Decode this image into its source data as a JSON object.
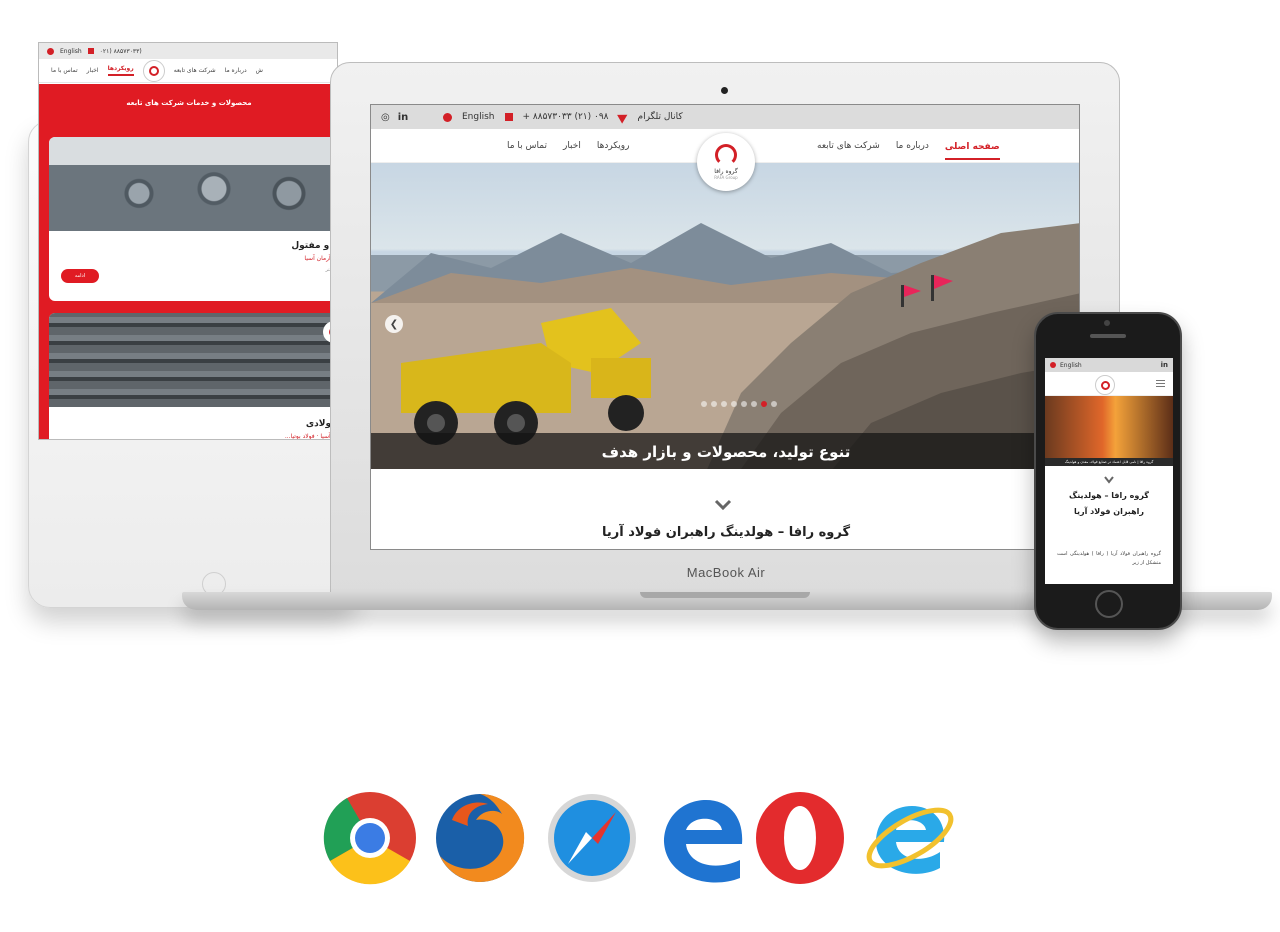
{
  "tablet": {
    "top": {
      "lang": "English",
      "phone": "۰۲۱) ۸۸۵۷۳۰۳۳)"
    },
    "nav": {
      "item1": "تماس با ما",
      "item2": "اخبار",
      "item3": "رویکردها",
      "item4": "شرکت های تابعه",
      "item5": "درباره ما",
      "item6": "ش"
    },
    "section_title": "محصولات و خدمات شرکت های تابعه",
    "card1": {
      "title": "د و مفتول",
      "subtitle": "ن آرمان آسیا",
      "tiny": "بیشتر",
      "button": "ادامه"
    },
    "card2": {
      "title": "فولادی",
      "subtitle": "ن آسیا · فولاد بوتیا..."
    }
  },
  "laptop": {
    "brand": "MacBook Air",
    "top": {
      "telegram": "کانال تلگرام",
      "phone": "۰۹۸ (۲۱) ۸۸۵۷۳۰۳۳ +",
      "lang": "English",
      "social1": "in",
      "social2": "◎"
    },
    "nav": {
      "home": "صفحه اصلی",
      "about": "درباره ما",
      "subsidiaries": "شرکت های تابعه",
      "approaches": "رویکردها",
      "news": "اخبار",
      "contact": "تماس با ما"
    },
    "logo": {
      "name": "گروه رافا",
      "sub": "RAFA Group"
    },
    "hero_caption": "تنوع تولید، محصولات و بازار هدف",
    "heading": "گروه رافا – هولدینگ راهبران فولاد آریا",
    "slider_count": 8,
    "slider_active": 6
  },
  "phone": {
    "top": {
      "lang": "English",
      "social": "in"
    },
    "hero_caption": "گروه رافا | نامی قابل اعتماد در صنایع فولاد، معدن و هولدینگ",
    "title_line1": "گروه رافا – هولدینگ",
    "title_line2": "راهبران فولاد آریا",
    "text": "گروه راهبران فولاد آریا ( رافا ) هولدینگی است متشکل از زیر"
  },
  "browsers": [
    "chrome-icon",
    "firefox-icon",
    "safari-icon",
    "edge-icon",
    "opera-icon",
    "internet-explorer-icon"
  ],
  "colors": {
    "brand_red": "#d32027",
    "dark_caption": "#141414"
  }
}
